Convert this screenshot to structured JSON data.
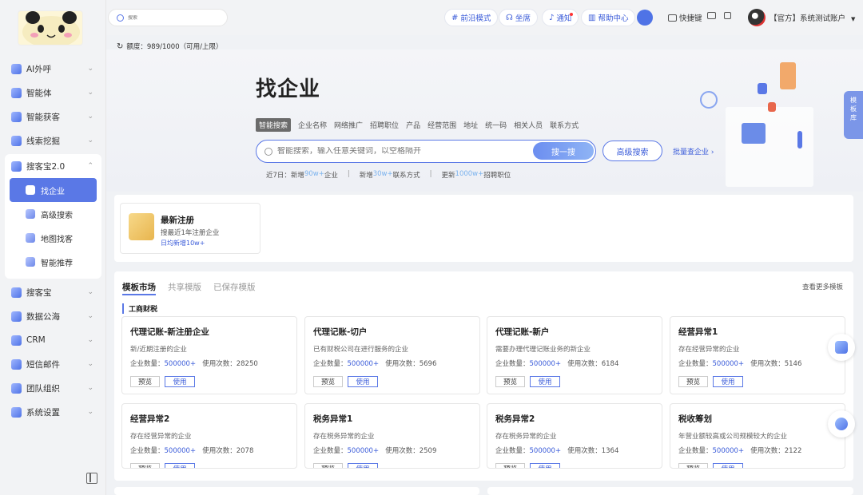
{
  "topbar": {
    "search_placeholder": "搜索",
    "frontier": "前沿模式",
    "seat": "坐席",
    "notice": "通知",
    "help": "帮助中心",
    "shortcut": "快捷键",
    "account": "【官方】系统测试账户"
  },
  "sidebar": {
    "items": [
      {
        "label": "AI外呼"
      },
      {
        "label": "智能体"
      },
      {
        "label": "智能获客"
      },
      {
        "label": "线索挖掘"
      }
    ],
    "group": {
      "label": "搜客宝2.0",
      "subs": [
        {
          "label": "找企业"
        },
        {
          "label": "高级搜索"
        },
        {
          "label": "地图找客"
        },
        {
          "label": "智能推荐"
        }
      ]
    },
    "items2": [
      {
        "label": "搜客宝"
      },
      {
        "label": "数据公海"
      },
      {
        "label": "CRM"
      },
      {
        "label": "短信邮件"
      },
      {
        "label": "团队组织"
      },
      {
        "label": "系统设置"
      }
    ]
  },
  "quota": {
    "text": "额度：989/1000（可用/上限）"
  },
  "hero": {
    "title": "找企业",
    "tabs": [
      "智能搜索",
      "企业名称",
      "网络推广",
      "招聘职位",
      "产品",
      "经营范围",
      "地址",
      "统一码",
      "相关人员",
      "联系方式"
    ],
    "search_placeholder": "智能搜索，输入任意关键词，以空格隔开",
    "search_button": "搜一搜",
    "advanced_button": "高级搜索",
    "batch_link": "批量查企业 ›",
    "stats": {
      "prefix": "近7日：",
      "s1_pre": "新增",
      "s1_val": "90w+",
      "s1_post": "企业",
      "s2_pre": "新增",
      "s2_val": "30w+",
      "s2_post": "联系方式",
      "s3_pre": "更新",
      "s3_val": "1000w+",
      "s3_post": "招聘职位"
    },
    "side_tab": "模板库"
  },
  "newreg": {
    "title": "最新注册",
    "desc": "搜最近1年注册企业",
    "daily": "日均新增10w+"
  },
  "templates": {
    "tabs": [
      "模板市场",
      "共享模版",
      "已保存模版"
    ],
    "more": "查看更多模板",
    "section": "工商财税",
    "count_label": "企业数量：",
    "uses_label": "使用次数：",
    "preview": "预览",
    "use": "使用",
    "cards": [
      {
        "name": "代理记账-新注册企业",
        "desc": "新/近期注册的企业",
        "count": "500000+",
        "uses": "28250"
      },
      {
        "name": "代理记账-切户",
        "desc": "已有财税公司在进行服务的企业",
        "count": "500000+",
        "uses": "5696"
      },
      {
        "name": "代理记账-新户",
        "desc": "需要办理代理记账业务的新企业",
        "count": "500000+",
        "uses": "6184"
      },
      {
        "name": "经营异常1",
        "desc": "存在经营异常的企业",
        "count": "500000+",
        "uses": "5146"
      },
      {
        "name": "经营异常2",
        "desc": "存在经营异常的企业",
        "count": "500000+",
        "uses": "2078"
      },
      {
        "name": "税务异常1",
        "desc": "存在税务异常的企业",
        "count": "500000+",
        "uses": "2509"
      },
      {
        "name": "税务异常2",
        "desc": "存在税务异常的企业",
        "count": "500000+",
        "uses": "1364"
      },
      {
        "name": "税收筹划",
        "desc": "年营业额较高或公司规模较大的企业",
        "count": "500000+",
        "uses": "2122"
      }
    ]
  },
  "colors": {
    "accent": "#5a78e6",
    "link": "#3a5bd9",
    "highlight": "#7ab2ee"
  }
}
